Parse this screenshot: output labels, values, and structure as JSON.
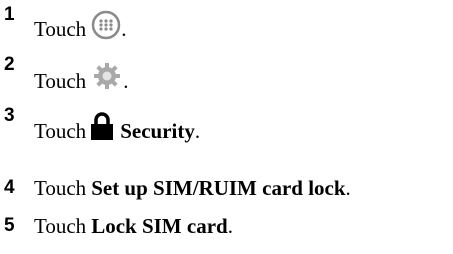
{
  "steps": [
    {
      "number": "1",
      "verb": "Touch",
      "icon": "apps-icon",
      "bold": "",
      "end": "."
    },
    {
      "number": "2",
      "verb": "Touch",
      "icon": "gear-icon",
      "bold": "",
      "end": "."
    },
    {
      "number": "3",
      "verb": "Touch",
      "icon": "lock-icon",
      "bold": "Security",
      "end": "."
    },
    {
      "number": "4",
      "verb": "Touch",
      "icon": "",
      "bold": "Set up SIM/RUIM card lock",
      "end": "."
    },
    {
      "number": "5",
      "verb": "Touch",
      "icon": "",
      "bold": "Lock SIM card",
      "end": "."
    }
  ]
}
